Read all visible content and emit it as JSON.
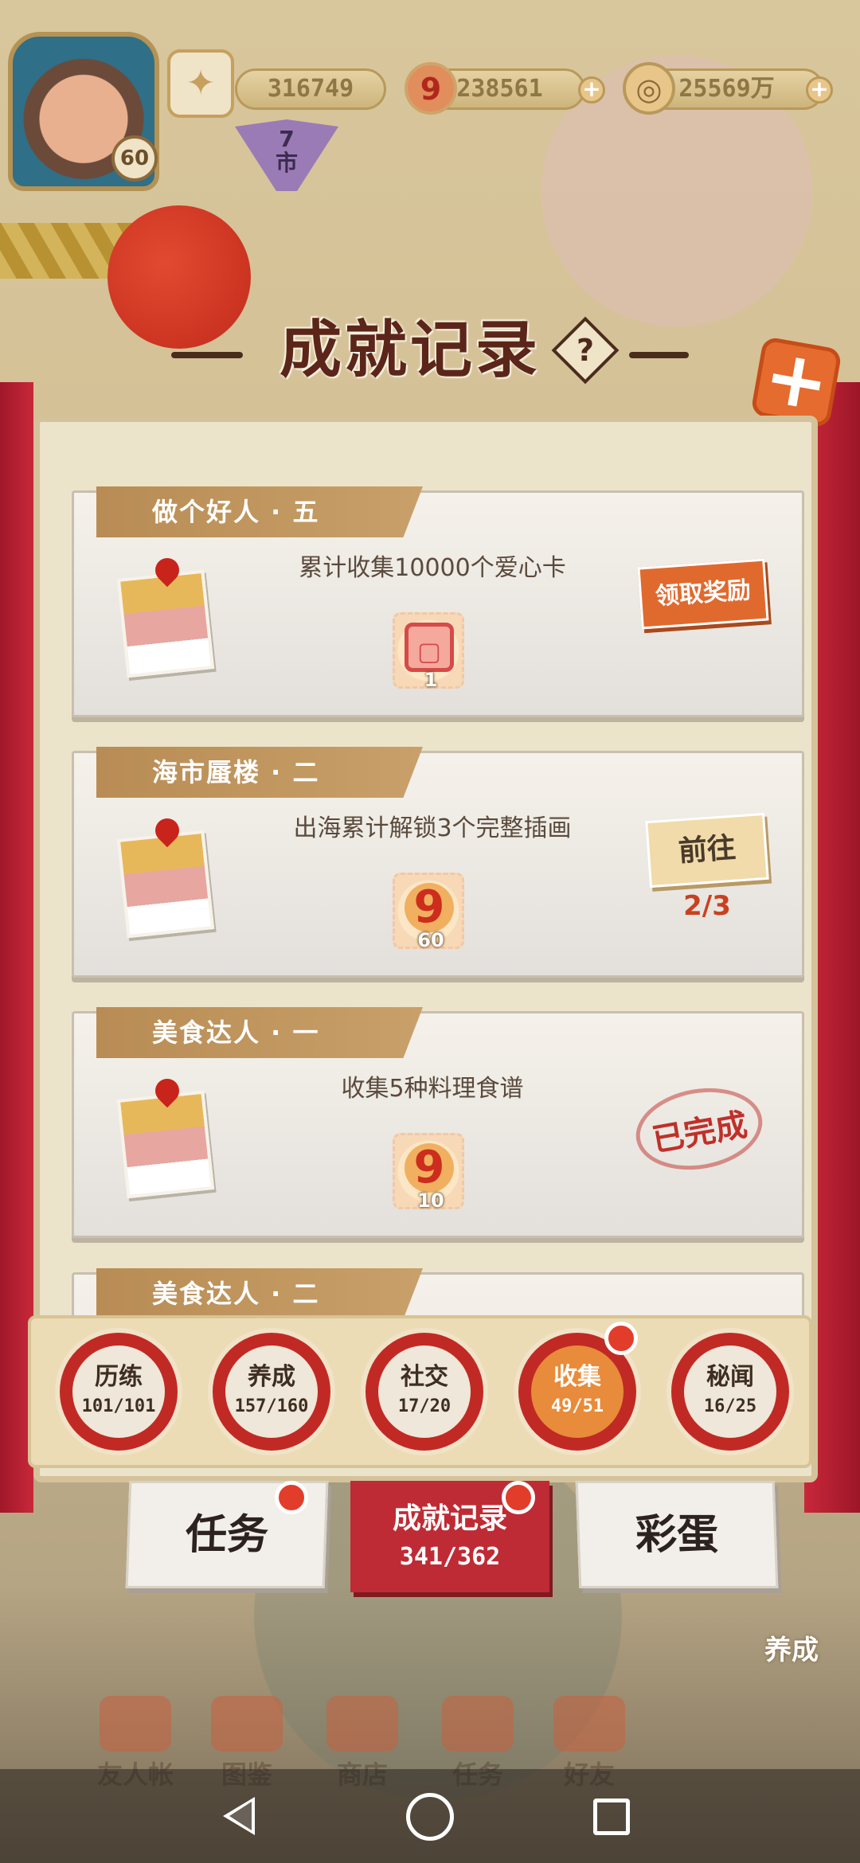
{
  "hud": {
    "level": "60",
    "stats": [
      {
        "name": "ticket",
        "value": "316749",
        "icon": "ticket-icon"
      },
      {
        "name": "nine-currency",
        "value": "238561",
        "icon": "red-nine-coin-icon",
        "glyph": "9"
      },
      {
        "name": "coin",
        "value": "25569万",
        "icon": "gold-coin-icon"
      }
    ],
    "market_label": "7\n市"
  },
  "title": "成就记录",
  "help_glyph": "?",
  "close_glyph": "+",
  "achievements": [
    {
      "name": "做个好人 · 五",
      "desc": "累计收集10000个爱心卡",
      "reward_icon": "frame-icon",
      "reward_glyph": "▢",
      "reward_qty": "1",
      "status": "claim",
      "action_label": "领取奖励"
    },
    {
      "name": "海市蜃楼 · 二",
      "desc": "出海累计解锁3个完整插画",
      "reward_icon": "nine-coin-icon",
      "reward_glyph": "9",
      "reward_qty": "60",
      "status": "goto",
      "action_label": "前往",
      "progress": "2/3"
    },
    {
      "name": "美食达人 · 一",
      "desc": "收集5种料理食谱",
      "reward_icon": "nine-coin-icon",
      "reward_glyph": "9",
      "reward_qty": "10",
      "status": "done",
      "action_label": "已完成"
    },
    {
      "name": "美食达人 · 二"
    }
  ],
  "categories": [
    {
      "label": "历练",
      "count": "101/101",
      "active": false
    },
    {
      "label": "养成",
      "count": "157/160",
      "active": false
    },
    {
      "label": "社交",
      "count": "17/20",
      "active": false
    },
    {
      "label": "收集",
      "count": "49/51",
      "active": true
    },
    {
      "label": "秘闻",
      "count": "16/25",
      "active": false
    }
  ],
  "tabs": {
    "task": "任务",
    "achievement": "成就记录",
    "achievement_count": "341/362",
    "easter_egg": "彩蛋"
  },
  "game_nav": [
    "友人帐",
    "图鉴",
    "商店",
    "任务",
    "好友"
  ],
  "feed_label": "养成",
  "colors": {
    "accent_red": "#bf2b34",
    "accent_orange": "#e06a2e",
    "panel_bg": "#ece3cb"
  }
}
